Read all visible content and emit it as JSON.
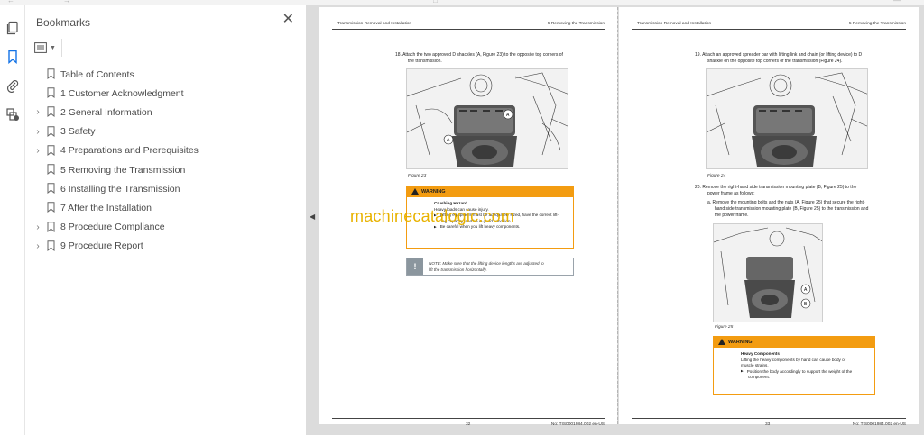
{
  "toolbar_hint": [
    "←",
    "→",
    "□",
    "—"
  ],
  "rail": [
    {
      "name": "pages-icon"
    },
    {
      "name": "bookmark-icon"
    },
    {
      "name": "attachment-icon"
    },
    {
      "name": "layers-icon"
    }
  ],
  "bookmarks": {
    "title": "Bookmarks",
    "close": "✕",
    "items": [
      {
        "label": "Table of Contents",
        "expandable": false
      },
      {
        "label": "1 Customer Acknowledgment",
        "expandable": false
      },
      {
        "label": "2 General Information",
        "expandable": true
      },
      {
        "label": "3 Safety",
        "expandable": true
      },
      {
        "label": "4 Preparations and Prerequisites",
        "expandable": true
      },
      {
        "label": "5 Removing the Transmission",
        "expandable": false
      },
      {
        "label": "6 Installing the Transmission",
        "expandable": false
      },
      {
        "label": "7 After the Installation",
        "expandable": false
      },
      {
        "label": "8 Procedure Compliance",
        "expandable": true
      },
      {
        "label": "9 Procedure Report",
        "expandable": true
      }
    ]
  },
  "pages": {
    "left": {
      "header_left": "Transmission Removal and Installation",
      "header_right": "5 Removing the Transmission",
      "step18": "18.  Attach the two approved D shackles (A, Figure 23) to the opposite top corners of",
      "step18b": "the transmission.",
      "fig_caption": "Figure 23",
      "warning_label": "WARNING",
      "warn_title": "Crushing Hazard",
      "warn_line1": "Heavy loads can cause injury.",
      "warn_b1a": "Lifting equipment must be adequately sized, have the correct lift-",
      "warn_b1b": "ing capacity, and be in good condition.",
      "warn_b2": "Be careful when you lift heavy components.",
      "note_icon": "!",
      "note_a": "NOTE: Make sure that the lifting device lengths are adjusted to",
      "note_b": "lift the transmission horizontally.",
      "footer_page": "32",
      "footer_doc": "No: TIS0001984.002 en-US"
    },
    "right": {
      "header_left": "Transmission Removal and Installation",
      "header_right": "5 Removing the Transmission",
      "step19a": "19.  Attach an approved spreader bar with lifting link and chain (or lifting device) to D",
      "step19b": "shackle on the opposite top corners of the transmission (Figure 24).",
      "fig24": "Figure 24",
      "step20a": "20.  Remove the right-hand side transmission mounting plate (B, Figure 25) to the",
      "step20b": "power frame as follows:",
      "sub_a1": "a.  Remove the mounting bolts and the nuts (A, Figure 25) that secure the right-",
      "sub_a2": "hand side transmission mounting plate (B, Figure 25) to the transmission and",
      "sub_a3": "the power frame.",
      "fig25": "Figure 25",
      "warning_label": "WARNING",
      "warn_title": "Heavy Components",
      "warn_l1": "Lifting the heavy components by hand can cause body or",
      "warn_l2": "muscle strains.",
      "warn_b1": "Position the body accordingly to support the weight of the",
      "warn_b1b": "component.",
      "footer_page": "33",
      "footer_doc": "No: TIS0001984.002 en-US"
    },
    "callouts": {
      "a": "A",
      "b": "B"
    }
  },
  "watermark": "machinecatalogic.com",
  "collapse_arrow": "◀",
  "colors": {
    "accent": "#1473e6",
    "warning": "#f39c11",
    "watermark": "#e8b200"
  }
}
